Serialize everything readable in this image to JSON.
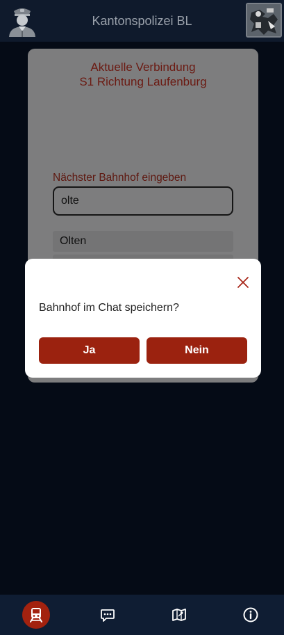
{
  "header": {
    "title": "Kantonspolizei BL"
  },
  "card": {
    "title_line1": "Aktuelle Verbindung",
    "title_line2": "S1 Richtung Laufenburg",
    "field_label": "Nächster Bahnhof eingeben",
    "input_value": "olte",
    "suggestions": [
      "Olten",
      ""
    ]
  },
  "dialog": {
    "question": "Bahnhof im Chat speichern?",
    "yes_label": "Ja",
    "no_label": "Nein"
  },
  "nav": {
    "items": [
      {
        "icon": "train-icon",
        "active": true
      },
      {
        "icon": "chat-icon",
        "active": false
      },
      {
        "icon": "map-icon",
        "active": false
      },
      {
        "icon": "info-icon",
        "active": false
      }
    ]
  },
  "colors": {
    "accent": "#9b220f",
    "background": "#050b16",
    "header": "#0f1a2c",
    "overlay_card": "#7d7d7e"
  }
}
